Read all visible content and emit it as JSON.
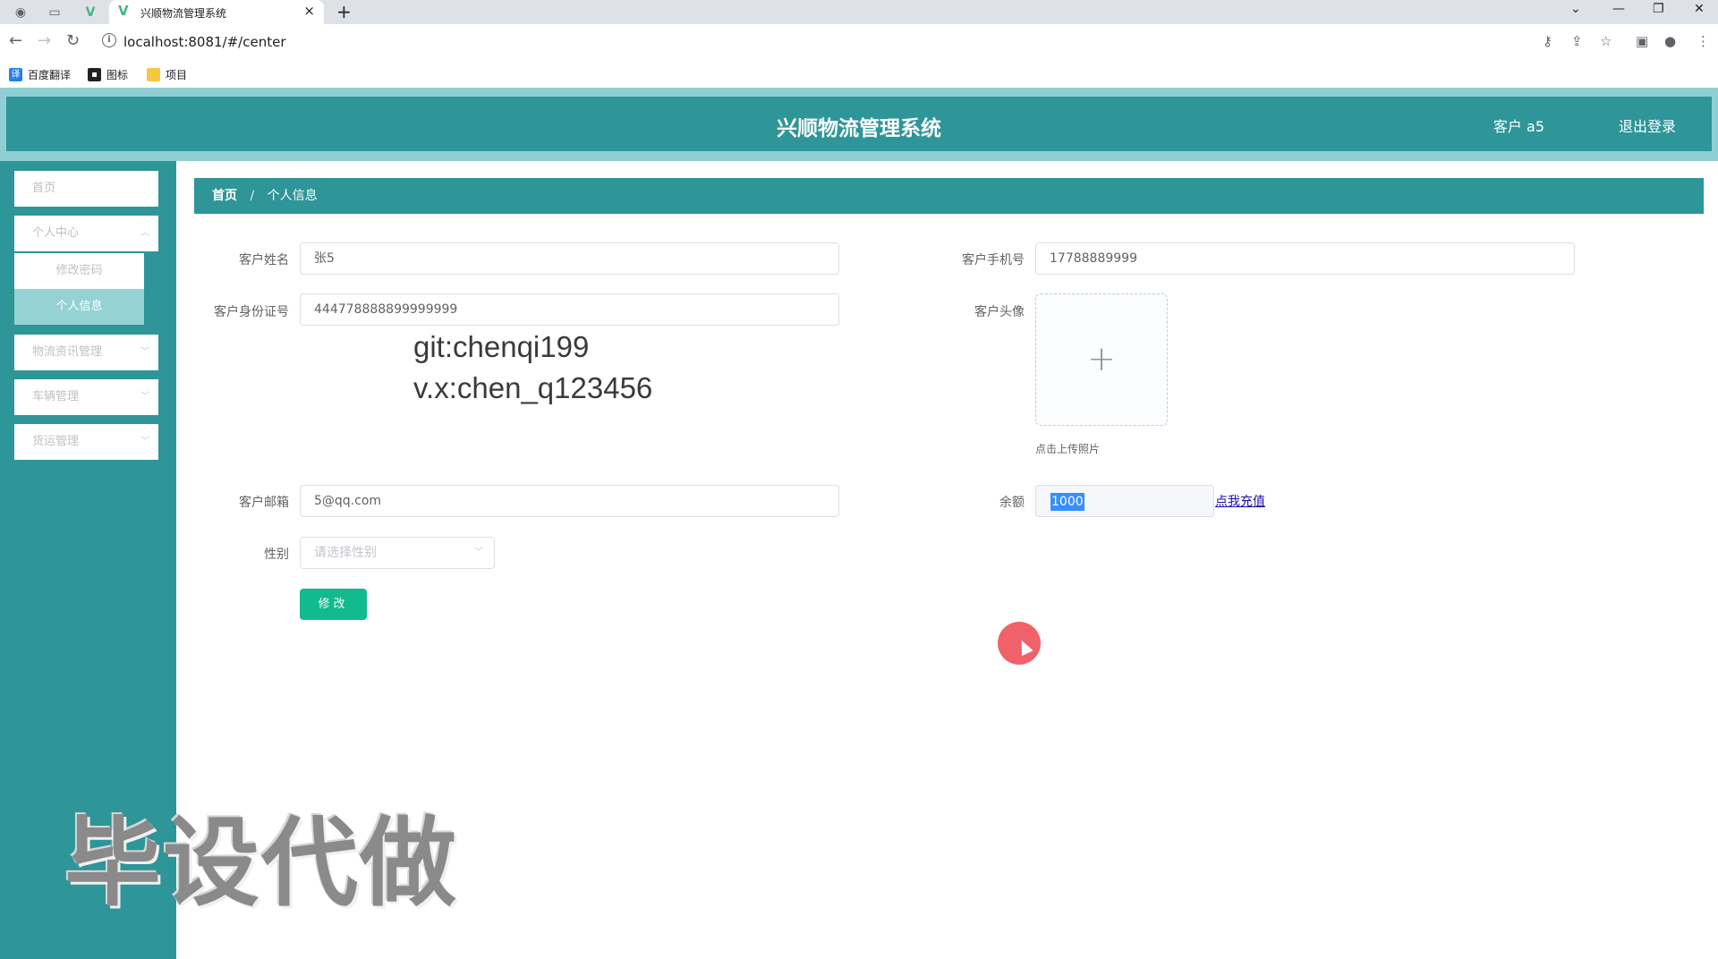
{
  "browser": {
    "tab_title": "兴顺物流管理系统",
    "url": "localhost:8081/#/center",
    "bookmarks": [
      "百度翻译",
      "图标",
      "项目"
    ]
  },
  "header": {
    "title": "兴顺物流管理系统",
    "user": "客户 a5",
    "logout": "退出登录"
  },
  "sidebar": {
    "home": "首页",
    "personal_center": "个人中心",
    "change_password": "修改密码",
    "personal_info": "个人信息",
    "logistics_news": "物流资讯管理",
    "vehicle_mgmt": "车辆管理",
    "freight_mgmt": "货运管理"
  },
  "breadcrumb": {
    "home": "首页",
    "sep": "/",
    "current": "个人信息"
  },
  "form": {
    "name_label": "客户姓名",
    "name_value": "张5",
    "phone_label": "客户手机号",
    "phone_value": "17788889999",
    "idcard_label": "客户身份证号",
    "idcard_value": "444778888899999999",
    "avatar_label": "客户头像",
    "upload_tip": "点击上传照片",
    "email_label": "客户邮箱",
    "email_value": "5@qq.com",
    "balance_label": "余额",
    "balance_value": "1000",
    "recharge": "点我充值",
    "gender_label": "性别",
    "gender_placeholder": "请选择性别",
    "submit": "修改"
  },
  "watermarks": {
    "line1": "git:chenqi199",
    "line2": "v.x:chen_q123456",
    "big": "毕设代做"
  },
  "colors": {
    "header": "#2e9598",
    "header_strip": "#8fcfd3",
    "active_submenu": "#94d2d3",
    "button": "#11bb8d"
  }
}
